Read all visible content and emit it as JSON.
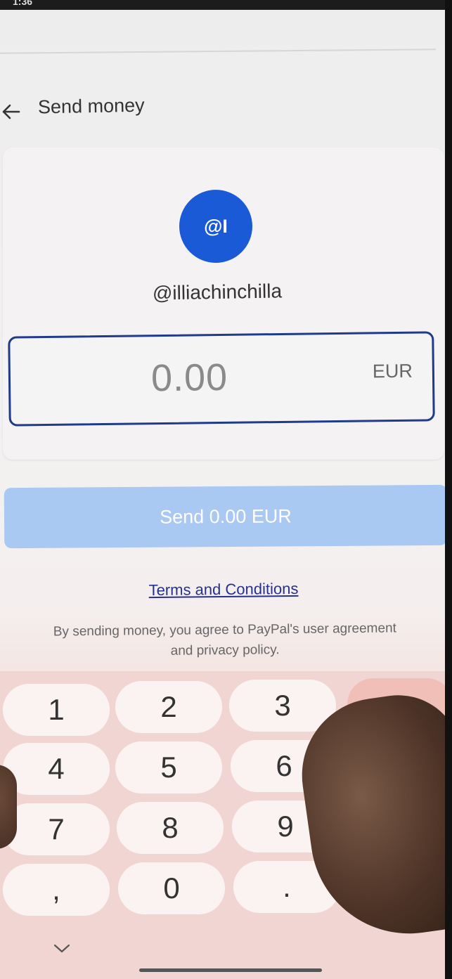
{
  "status_bar": {
    "time": "1:36"
  },
  "header": {
    "back_icon": "arrow-left-icon",
    "title": "Send money"
  },
  "recipient": {
    "avatar_initials": "@I",
    "avatar_color": "#1a5ad6",
    "username": "@illiachinchilla"
  },
  "amount": {
    "value": "0.00",
    "currency": "EUR",
    "border_color": "#1f3b8a"
  },
  "send_button": {
    "label": "Send 0.00 EUR",
    "color": "#a9c8f2"
  },
  "terms": {
    "link_label": "Terms and Conditions",
    "legal_text": "By sending money, you agree to PayPal's user agreement and privacy policy."
  },
  "keypad": {
    "keys": [
      "1",
      "2",
      "3",
      "4",
      "5",
      "6",
      "7",
      "8",
      "9",
      ",",
      "0",
      "."
    ],
    "collapse_icon": "chevron-down-icon"
  }
}
